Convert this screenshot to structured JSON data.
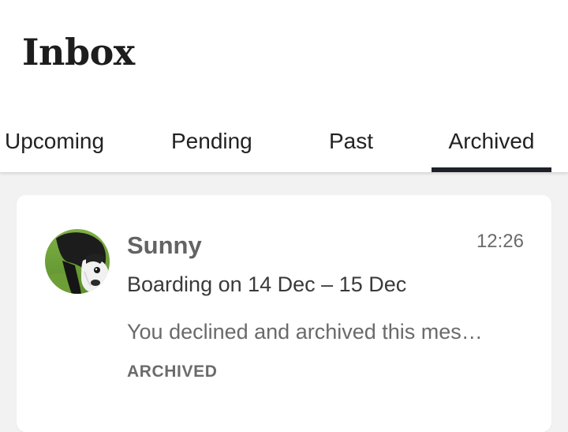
{
  "header": {
    "title": "Inbox"
  },
  "tabs": [
    {
      "label": "Upcoming",
      "active": false
    },
    {
      "label": "Pending",
      "active": false
    },
    {
      "label": "Past",
      "active": false
    },
    {
      "label": "Archived",
      "active": true
    }
  ],
  "messages": [
    {
      "sender": "Sunny",
      "time": "12:26",
      "booking": "Boarding on 14 Dec – 15 Dec",
      "preview": "You declined and archived this mes…",
      "status": "ARCHIVED",
      "avatar_icon": "dog-photo"
    }
  ],
  "colors": {
    "tab_underline": "#1f2128",
    "background": "#f2f2f2",
    "card": "#ffffff"
  }
}
